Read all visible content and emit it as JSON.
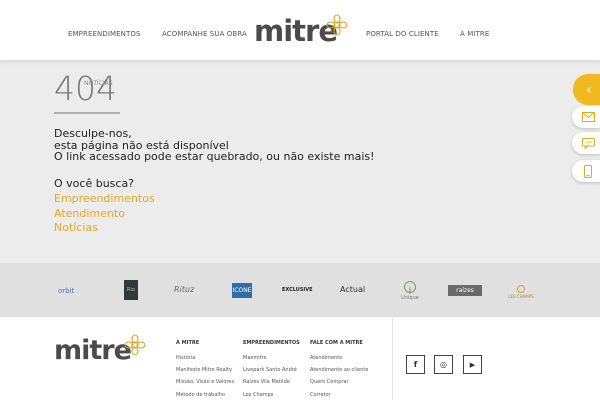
{
  "header": {
    "nav": [
      "EMPREENDIMENTOS",
      "ACOMPANHE SUA OBRA",
      "PORTAL DO CLIENTE",
      "A MITRE"
    ],
    "logo_text": "mitre"
  },
  "error": {
    "code": "404",
    "label": "NOTÍCIAS",
    "lines": [
      "Desculpe-nos,",
      "esta página não está disponível",
      "O link acessado pode estar quebrado, ou não existe mais!"
    ],
    "question": "O você busca?",
    "links": [
      "Empreendimentos",
      "Atendimento",
      "Notícias"
    ]
  },
  "partners": [
    "orbit",
    "Rio",
    "Rituz",
    "ICONE",
    "EXCLUSIVE",
    "Actual",
    "Unique",
    "raízes",
    "LES CHAMPS"
  ],
  "footer": {
    "logo_text": "mitre",
    "columns": [
      {
        "title": "A MITRE",
        "items": [
          "História",
          "Manifesto Mitre Realty",
          "Missão, Visão e Valores",
          "Método de trabalho"
        ]
      },
      {
        "title": "EMPREENDIMENTOS",
        "items": [
          "Maxmitre",
          "Livepark Santo André",
          "Raízes Vila Matilde",
          "Les Champs"
        ]
      },
      {
        "title": "FALE COM A MITRE",
        "items": [
          "Atendimento",
          "Atendimento ao cliente",
          "Quero Comprar",
          "Corretor"
        ]
      }
    ],
    "social": [
      "f",
      "◎",
      "▶"
    ]
  },
  "colors": {
    "accent": "#e2a822",
    "tab": "#f1b81f"
  }
}
